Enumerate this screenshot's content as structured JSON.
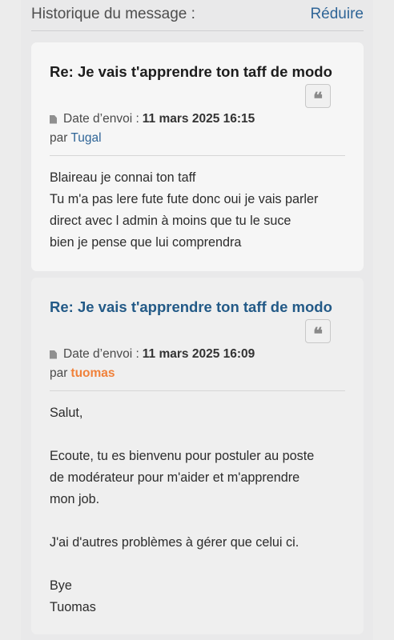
{
  "history": {
    "title": "Historique du message :",
    "collapse_label": "Réduire"
  },
  "posts": [
    {
      "title": "Re: Je vais t'apprendre ton taff de modo",
      "date_label": "Date d’envoi :",
      "date": "11 mars 2025 16:15",
      "by_label": "par",
      "author": "Tugal",
      "lines": [
        "Blaireau je connai ton taff",
        "Tu m'a pas lere fute fute donc oui je vais parler",
        "direct avec l admin à moins que tu le suce",
        "bien je pense que lui comprendra"
      ]
    },
    {
      "title": "Re: Je vais t'apprendre ton taff de modo",
      "date_label": "Date d’envoi :",
      "date": "11 mars 2025 16:09",
      "by_label": "par",
      "author": "tuomas",
      "lines": [
        "Salut,",
        "",
        "Ecoute, tu es bienvenu pour postuler au poste",
        "de modérateur pour m'aider et m'apprendre",
        "mon job.",
        "",
        "J'ai d'autres problèmes à gérer que celui ci.",
        "",
        "Bye",
        "Tuomas"
      ]
    }
  ],
  "icons": {
    "quote": "quote-icon",
    "document": "document-icon"
  },
  "colors": {
    "link": "#2f6597",
    "moderator_author": "#f0813a",
    "post_title_blue": "#235a87"
  }
}
